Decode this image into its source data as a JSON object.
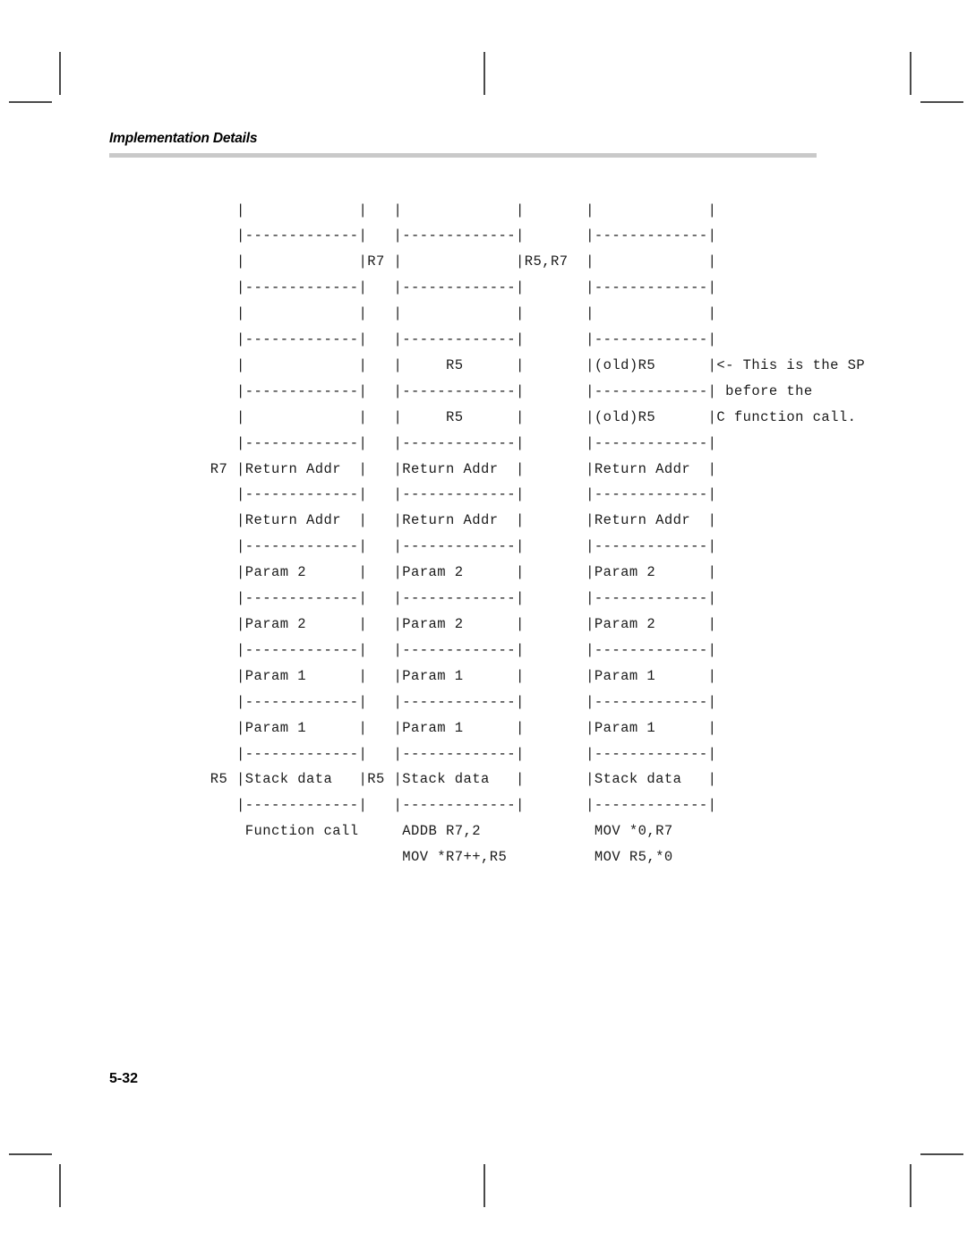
{
  "header": {
    "title": "Implementation Details",
    "rule_color": "#c9c9c9"
  },
  "folio": {
    "page_number": "5-32"
  },
  "diagram": {
    "description": "ASCII-art stack frame diagram with three stack columns showing register usage before and after a C function call",
    "columns": 3,
    "registers": [
      "R7",
      "R5",
      "R5,R7",
      "(old)R5"
    ],
    "annotation_lines": [
      "<- This is the SP",
      "before the",
      "C function call."
    ],
    "cell_labels": [
      "Return Addr",
      "Param 2",
      "Param 1",
      "Stack data",
      "R5",
      "(old)R5",
      "R7",
      "R5,R7"
    ],
    "captions": {
      "column1": [
        "Function call"
      ],
      "column2": [
        "ADDB R7,2",
        "MOV *R7++,R5"
      ],
      "column3": [
        "MOV *0,R7",
        "MOV R5,*0"
      ]
    },
    "art": "    |             |   |             |       |             |\n    |-------------|   |-------------|       |-------------|\n    |             |R7 |             |R5,R7  |             |\n    |-------------|   |-------------|       |-------------|\n    |             |   |             |       |             |\n    |-------------|   |-------------|       |-------------|\n    |             |   |     R5      |       |(old)R5      |<- This is the SP\n    |-------------|   |-------------|       |-------------| before the\n    |             |   |     R5      |       |(old)R5      |C function call.\n    |-------------|   |-------------|       |-------------|\n R7 |Return Addr  |   |Return Addr  |       |Return Addr  |\n    |-------------|   |-------------|       |-------------|\n    |Return Addr  |   |Return Addr  |       |Return Addr  |\n    |-------------|   |-------------|       |-------------|\n    |Param 2      |   |Param 2      |       |Param 2      |\n    |-------------|   |-------------|       |-------------|\n    |Param 2      |   |Param 2      |       |Param 2      |\n    |-------------|   |-------------|       |-------------|\n    |Param 1      |   |Param 1      |       |Param 1      |\n    |-------------|   |-------------|       |-------------|\n    |Param 1      |   |Param 1      |       |Param 1      |\n    |-------------|   |-------------|       |-------------|\n R5 |Stack data   |R5 |Stack data   |       |Stack data   |\n    |-------------|   |-------------|       |-------------|\n     Function call     ADDB R7,2             MOV *0,R7\n                       MOV *R7++,R5          MOV R5,*0"
  }
}
